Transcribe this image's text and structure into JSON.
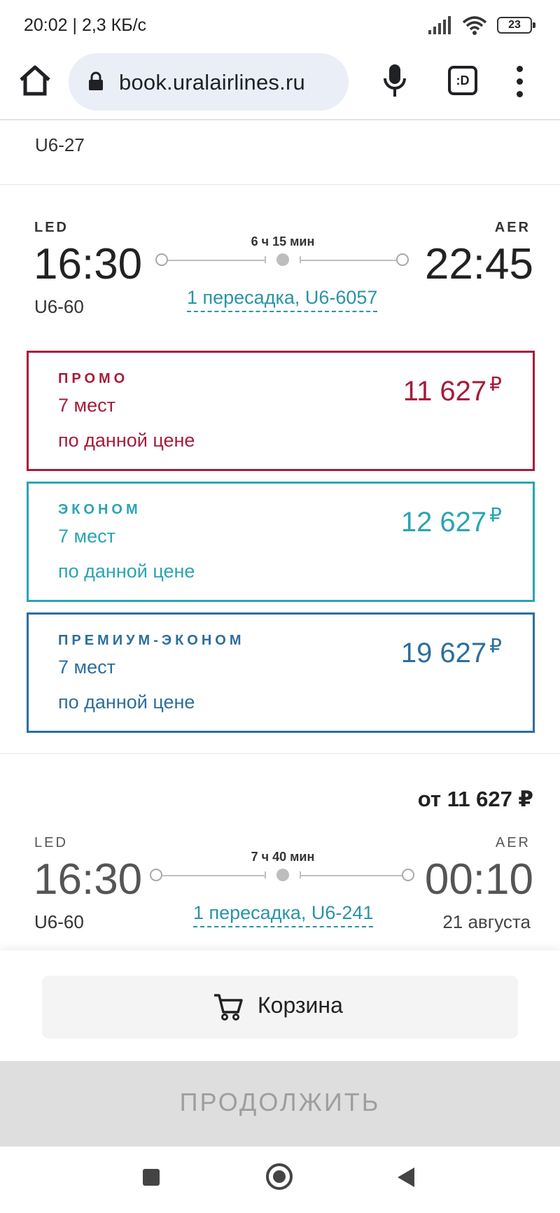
{
  "status_bar": {
    "text": "20:02 | 2,3 КБ/с",
    "battery": "23"
  },
  "browser": {
    "url": "book.uralairlines.ru",
    "tabs_label": ":D"
  },
  "previous_flight": {
    "code": "U6-27"
  },
  "flight1": {
    "from": "LED",
    "to": "AER",
    "dep_time": "16:30",
    "arr_time": "22:45",
    "code": "U6-60",
    "duration": "6 ч 15 мин",
    "transfer": "1 пересадка, U6-6057"
  },
  "fares": [
    {
      "name": "ПРОМО",
      "seats": "7 мест",
      "note": "по данной цене",
      "price": "11 627",
      "currency": "₽",
      "color": "#a51c3c"
    },
    {
      "name": "ЭКОНОМ",
      "seats": "7 мест",
      "note": "по данной цене",
      "price": "12 627",
      "currency": "₽",
      "color": "#2aa4b4"
    },
    {
      "name": "ПРЕМИУМ-ЭКОНОМ",
      "seats": "7 мест",
      "note": "по данной цене",
      "price": "19 627",
      "currency": "₽",
      "color": "#2d6e9b"
    }
  ],
  "flight2": {
    "from_price": "от 11 627 ₽",
    "from": "LED",
    "to": "AER",
    "dep_time": "16:30",
    "arr_time": "00:10",
    "code": "U6-60",
    "duration": "7 ч 40 мин",
    "transfer": "1 пересадка, U6-241",
    "arr_date": "21 августа"
  },
  "bottom": {
    "cart_label": "Корзина",
    "continue_label": "ПРОДОЛЖИТЬ"
  }
}
